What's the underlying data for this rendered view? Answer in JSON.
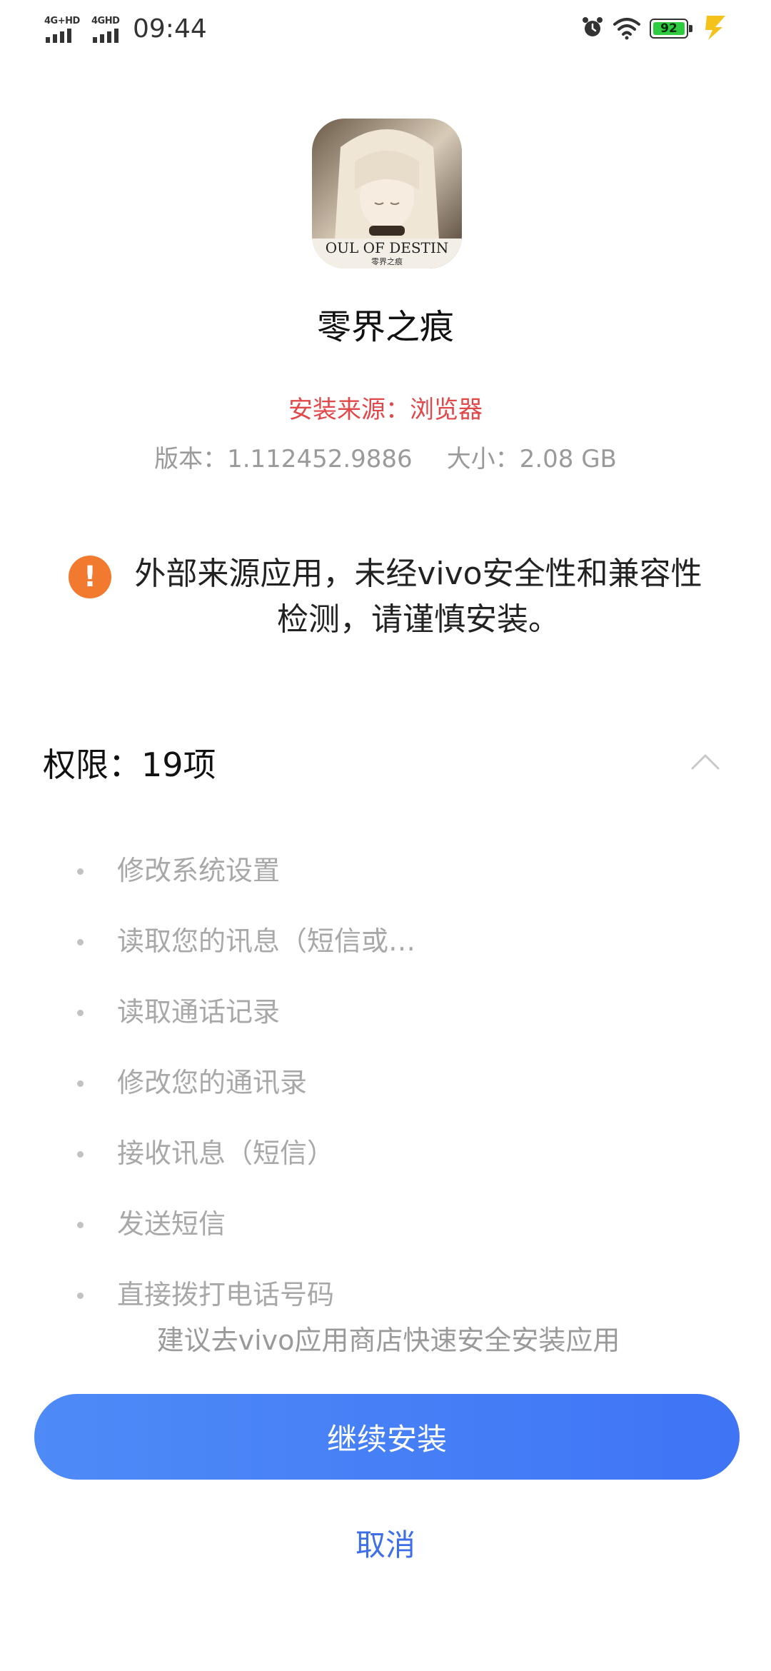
{
  "status_bar": {
    "sim1_label": "4G+HD",
    "sim2_label": "4GHD",
    "time": "09:44",
    "battery_percent": "92",
    "icons": [
      "signal-icon",
      "alarm-icon",
      "wifi-icon",
      "battery-icon",
      "charging-icon"
    ]
  },
  "app": {
    "name": "零界之痕",
    "icon_text": "OUL OF DESTIN",
    "icon_subtext": "零界之痕",
    "install_source": "安装来源：浏览器",
    "version": "版本：1.112452.9886",
    "size": "大小：2.08 GB"
  },
  "warning": {
    "icon": "exclamation-icon",
    "text": "外部来源应用，未经vivo安全性和兼容性检测，请谨慎安装。"
  },
  "permissions": {
    "title": "权限：19项",
    "items": [
      "修改系统设置",
      "读取您的讯息（短信或…",
      "读取通话记录",
      "修改您的通讯录",
      "接收讯息（短信）",
      "发送短信",
      "直接拨打电话号码"
    ]
  },
  "suggestion": "建议去vivo应用商店快速安全安装应用",
  "buttons": {
    "continue": "继续安装",
    "cancel": "取消"
  },
  "colors": {
    "accent": "#3f74f5",
    "warning": "#f27a2e",
    "source_red": "#e0484a",
    "battery_green": "#2ecc40"
  }
}
